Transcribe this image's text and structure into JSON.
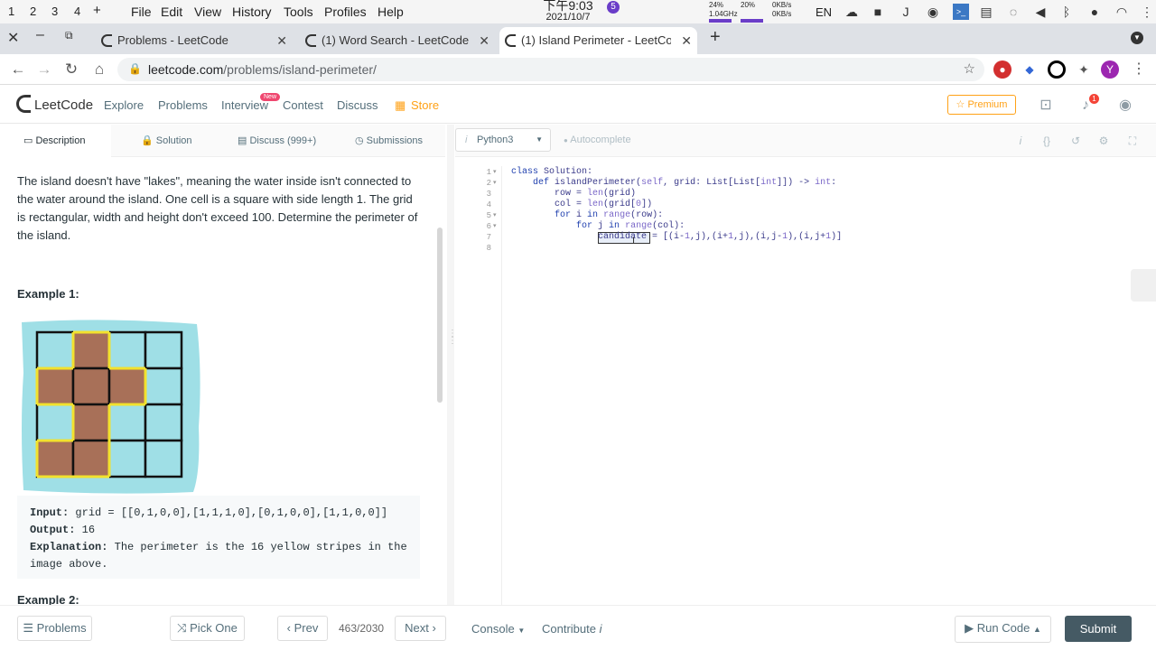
{
  "os": {
    "workspaces": [
      "1",
      "2",
      "3",
      "4",
      "+"
    ],
    "menu": [
      "File",
      "Edit",
      "View",
      "History",
      "Tools",
      "Profiles",
      "Help"
    ],
    "time": "下午9:03",
    "date": "2021/10/7",
    "notif_count": "5",
    "cpu": "24%",
    "cpu_freq": "1.04GHz",
    "mem": "20%",
    "net_up": "0KB/s",
    "net_down": "0KB/s",
    "lang": "EN"
  },
  "browser": {
    "tabs": [
      {
        "title": "Problems - LeetCode"
      },
      {
        "title": "(1) Word Search - LeetCode"
      },
      {
        "title": "(1) Island Perimeter - LeetCod"
      }
    ],
    "url_domain": "leetcode.com",
    "url_path": "/problems/island-perimeter/",
    "profile_initial": "Y"
  },
  "lc_nav": {
    "logo": "LeetCode",
    "links": [
      "Explore",
      "Problems",
      "Interview",
      "Contest",
      "Discuss"
    ],
    "new_badge": "New",
    "store": "Store",
    "premium": "Premium",
    "notif_count": "1"
  },
  "left_tabs": [
    "Description",
    "Solution",
    "Discuss (999+)",
    "Submissions"
  ],
  "description": {
    "paragraph": "The island doesn't have \"lakes\", meaning the water inside isn't connected to the water around the island. One cell is a square with side length 1. The grid is rectangular, width and height don't exceed 100. Determine the perimeter of the island.",
    "example1_title": "Example 1:",
    "example2_title": "Example 2:",
    "input_label": "Input:",
    "input_value": " grid = [[0,1,0,0],[1,1,1,0],[0,1,0,0],[1,1,0,0]]",
    "output_label": "Output:",
    "output_value": " 16",
    "explanation_label": "Explanation:",
    "explanation_value": " The perimeter is the 16 yellow stripes in the image above.",
    "grid": [
      [
        0,
        1,
        0,
        0
      ],
      [
        1,
        1,
        1,
        0
      ],
      [
        0,
        1,
        0,
        0
      ],
      [
        1,
        1,
        0,
        0
      ]
    ],
    "colors": {
      "water": "#9fdfe6",
      "land": "#a87058",
      "border": "#f2e22e"
    }
  },
  "editor": {
    "language": "Python3",
    "autocomplete": "Autocomplete",
    "line_numbers": [
      "1",
      "2",
      "3",
      "4",
      "5",
      "6",
      "7",
      "8"
    ]
  },
  "bottom": {
    "problems": "Problems",
    "pick_one": "Pick One",
    "prev": "Prev",
    "page": "463/2030",
    "next": "Next",
    "console": "Console",
    "contribute": "Contribute",
    "run_code": "Run Code",
    "submit": "Submit"
  }
}
